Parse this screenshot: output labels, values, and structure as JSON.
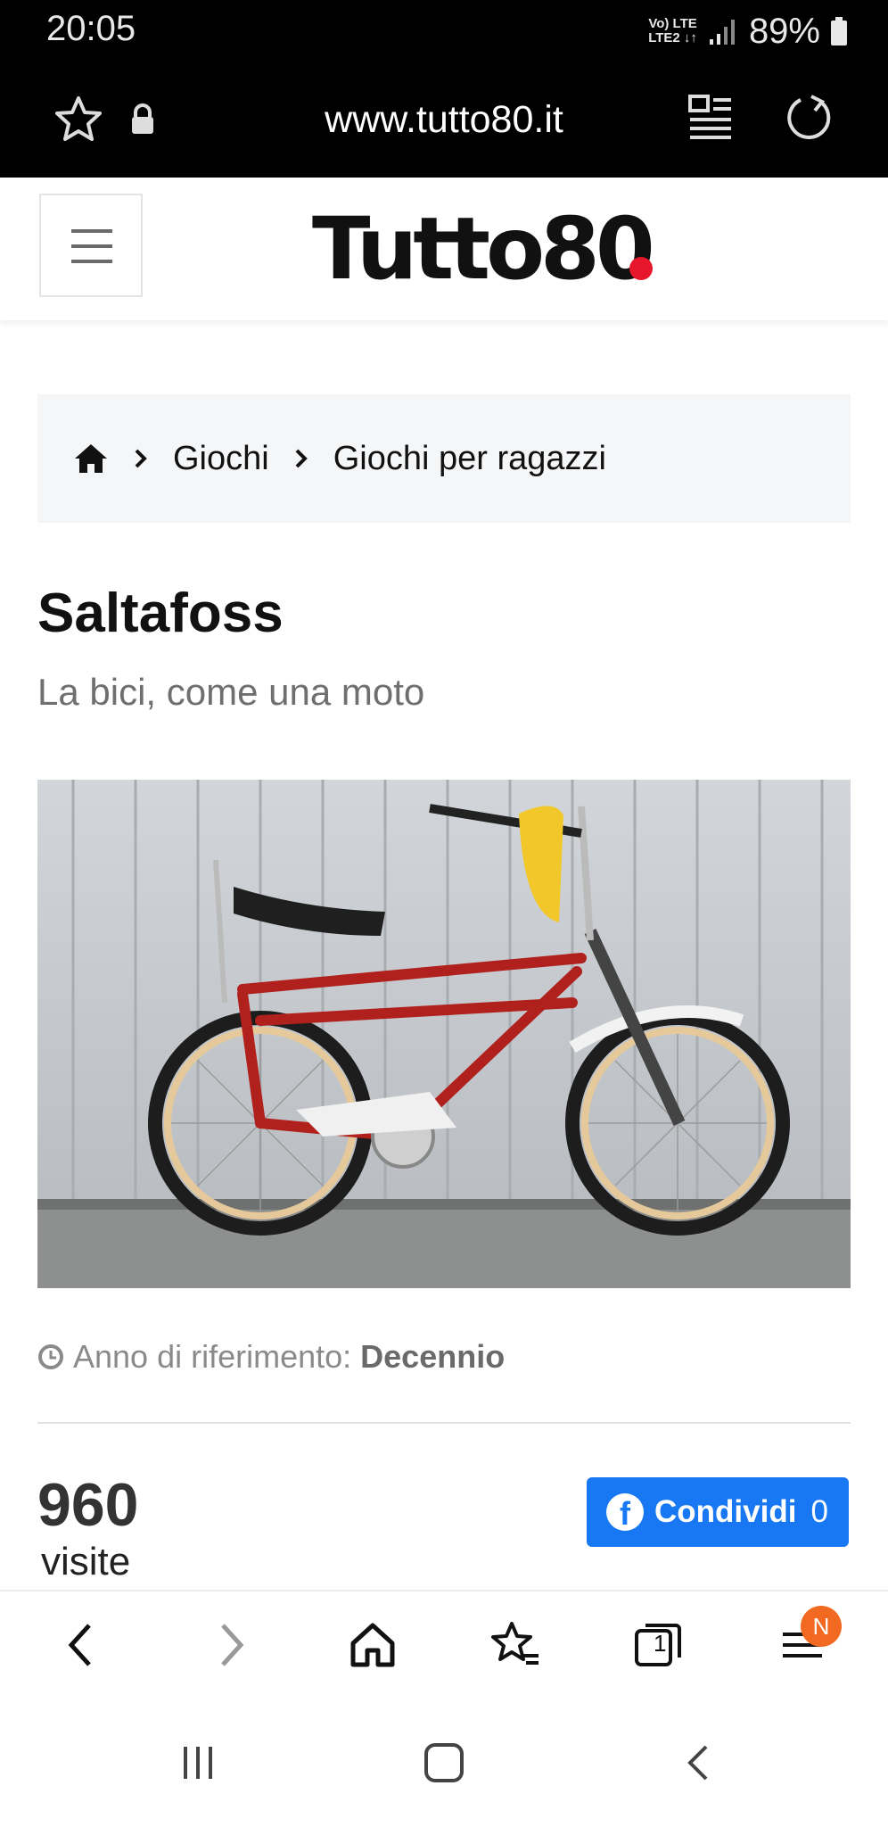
{
  "status_bar": {
    "time": "20:05",
    "net_top": "Vo) LTE",
    "net_bottom": "LTE2 ↓↑",
    "battery": "89%"
  },
  "browser": {
    "url": "www.tutto80.it",
    "icons": [
      "star-icon",
      "lock-icon",
      "reader-mode-icon",
      "reload-icon"
    ]
  },
  "site": {
    "logo": "Tutto80",
    "logo_dot_color": "#e8162a"
  },
  "breadcrumb": {
    "items": [
      "Giochi",
      "Giochi per ragazzi"
    ]
  },
  "article": {
    "title": "Saltafoss",
    "subtitle": "La bici, come una moto",
    "meta_label": "Anno di riferimento:",
    "meta_value": "Decennio",
    "views_count": "960",
    "views_label": "visite",
    "share_label": "Condividi",
    "share_count": "0"
  },
  "bottom_nav": {
    "tabs_count": "1",
    "menu_badge": "N",
    "badge_color": "#f26a21"
  },
  "colors": {
    "facebook_blue": "#1877f2",
    "accent_red": "#e8162a"
  }
}
